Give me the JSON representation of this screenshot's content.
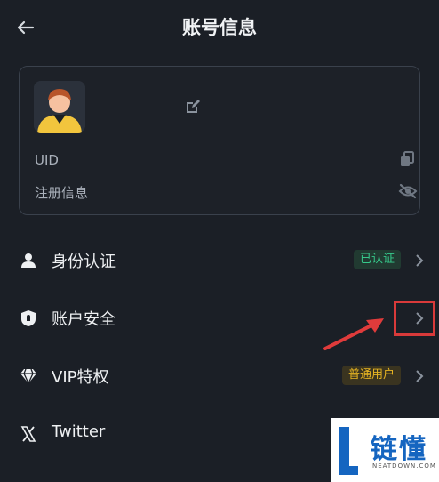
{
  "header": {
    "title": "账号信息"
  },
  "account_card": {
    "uid_label": "UID",
    "registration_label": "注册信息"
  },
  "menu": [
    {
      "label": "身份认证",
      "icon": "user-icon",
      "badge": "已认证"
    },
    {
      "label": "账户安全",
      "icon": "shield-lock-icon"
    },
    {
      "label": "VIP特权",
      "icon": "diamond-icon",
      "badge": "普通用户"
    },
    {
      "label": "Twitter",
      "icon": "x-logo-icon"
    }
  ],
  "watermark": {
    "text": "链懂",
    "subtext": "NEATDOWN.COM"
  },
  "colors": {
    "background": "#1b1f26",
    "verified": "#36c98b",
    "vip": "#e6b422",
    "annotation": "#d93a3a",
    "watermark_blue": "#1565c0"
  }
}
